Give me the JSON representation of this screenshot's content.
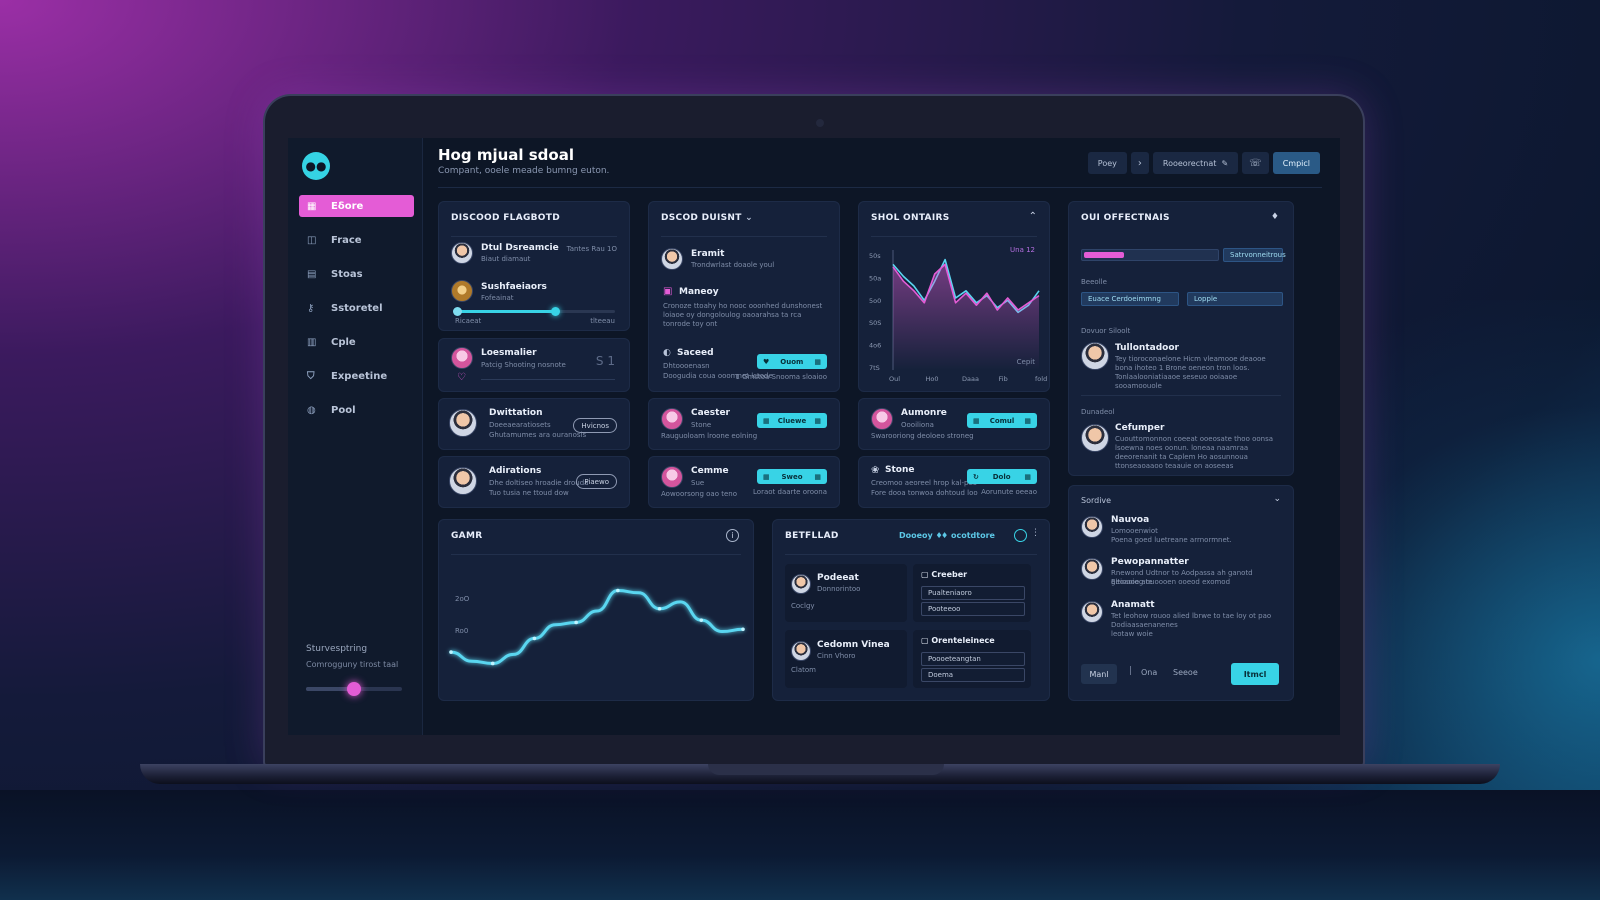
{
  "colors": {
    "accent_pink": "#e45cd6",
    "accent_cyan": "#38d3e6",
    "panel": "#15213a",
    "screen_bg": "#0d1626"
  },
  "sidebar": {
    "logo_icon": "chat-bubble-icon",
    "items": [
      {
        "label": "Eδore",
        "icon": "grid-icon",
        "active": true
      },
      {
        "label": "Frace",
        "icon": "box-icon"
      },
      {
        "label": "Stoas",
        "icon": "calendar-icon"
      },
      {
        "label": "Sstoretel",
        "icon": "key-icon"
      },
      {
        "label": "Cple",
        "icon": "table-icon"
      },
      {
        "label": "Expeetine",
        "icon": "shield-icon"
      },
      {
        "label": "Pool",
        "icon": "globe-icon"
      }
    ],
    "footer_title": "Sturvesptring",
    "footer_sub": "Comrogguny tirost taal",
    "slider_value": 0.5
  },
  "header": {
    "title": "Hog mjual sdoal",
    "subtitle": "Compant, ooele meade bumng euton.",
    "actions": {
      "btn1": "Poey",
      "btn2": "Rooeorectnat",
      "btn3": "Cmpicl"
    }
  },
  "card_flagboard": {
    "title": "DISCOOD FLAGBOTD",
    "row1": {
      "name": "Dtul Dsreamcie",
      "sub": "Biaut diamaut",
      "meta": "Tantes Rau 1O"
    },
    "row2": {
      "name": "Sushfaeiaors",
      "sub": "Fofeainat"
    },
    "slider_labels": {
      "left": "Ricaeat",
      "right": "tlteeau"
    },
    "slider_value": 0.62
  },
  "card_loesmaller": {
    "name": "Loesmalier",
    "sub": "Patcig Shooting nosnote",
    "meta": "S 1"
  },
  "card_dwittation": {
    "name": "Dwittation",
    "sub1": "Doeeaearatiosets",
    "sub2": "Ghutamumes ara ouranosis",
    "btn": "Hvicnos"
  },
  "card_adirations": {
    "name": "Adirations",
    "sub1": "Dhe doltiseo hroadie drouda",
    "sub2": "Tuo tusia ne ttoud dow",
    "btn": "Piaewo"
  },
  "card_dusgnt": {
    "title": "DSCOD DUISNT",
    "row1": {
      "name": "Eramit",
      "sub": "Trondwrlast doaole youl"
    },
    "row2": {
      "name": "Maneoy",
      "text": "Cronoze ttoahy ho nooc ooonhed dunshonest loiaoe oy dongoloulog oaoarahsa ta rca tonrode toy ont"
    },
    "row3": {
      "name": "Saceed",
      "sub1": "Dhtoooenasn",
      "sub2": "Doogudia coua ooomnet lctode",
      "btn": "Ouom",
      "btn_meta": "1 Gmstoa Snooma sloaioo"
    }
  },
  "card_caester": {
    "name": "Caester",
    "sub1": "Stone",
    "sub2": "Rauguoloam lroone eolning",
    "btn": "Cluewe"
  },
  "card_cemme": {
    "name": "Cemme",
    "sub1": "Sue",
    "sub2": "Aowoorsong oao teno",
    "btn": "Sweo",
    "btn_meta": "Loraot daarte oroona"
  },
  "card_shol": {
    "title": "SHOL ONTAIRS",
    "legend": "Una 12",
    "corner_label": "Cepit"
  },
  "card_aumonre": {
    "name": "Aumonre",
    "sub1": "Oooiliona",
    "sub2": "Swarooriong deoloeo stroneg",
    "btn": "Comul"
  },
  "card_stone": {
    "name": "Stone",
    "sub1": "Creomoo aeoreel hrop kal-peo",
    "sub2": "Fore dooa tonwoa dohtoud loo",
    "btn": "Dolo",
    "btn_meta": "Aorunute oeeao"
  },
  "card_effectnais": {
    "title": "OUI OFFECTNAIS",
    "progress": 0.3,
    "progress_btn": "Satrvonneitrous",
    "section1": "Beeolle",
    "chip1": "Euace Cerdoeimmng",
    "chip2": "Lopple",
    "section2": "Dovuor Siloolt",
    "person1": {
      "name": "Tullontadoor",
      "text": "Tey tioroconaelone Hicm vleamooe deaooe bona ihoteo 1 Brone oeneon tron loos. Tonlaalooniatiaaoe seseuo ooiaaoe sooamoouole"
    },
    "section3": "Dunadeol",
    "person2": {
      "name": "Cefumper",
      "text": "Cuouttomonnon coeeat ooeosate thoo oonsa lsoewna noes oonun. loneaa naamraa deeorenanit ta Caplem Ho aosunnoua ttonseaoaaoo teaauie on aoseeas"
    }
  },
  "card_sordive": {
    "title": "Sordive",
    "people": [
      {
        "name": "Nauvoa",
        "text1": "Lomooenwiot",
        "text2": "Poena goed luetreane arrnormnet."
      },
      {
        "name": "Pewopannatter",
        "text1": "Rnewond Udtnor to Aodpassa ah ganotd geoaoiog te",
        "text2": "Eltioooe aouoooen ooeod exomod"
      },
      {
        "name": "Anamatt",
        "text1": "Tet leohow rouoo alied lbrwe to tae loy ot pao",
        "text2": "Dodiaasaenanenes",
        "text3": "leotaw woie"
      }
    ],
    "btns": {
      "first": "Manl",
      "b2": "Ona",
      "b3": "Seeoe",
      "primary": "Itmcl"
    }
  },
  "card_gamr": {
    "title": "GAMR",
    "y_label_top": "2oO",
    "y_label_mid": "Ro0"
  },
  "card_betflad": {
    "title": "BETFLLAD",
    "filter1": "Dooeoy ♦",
    "filter2": "♦ ocotdtore",
    "person1": {
      "name": "Podeeat",
      "sub1": "Donnorintoo",
      "sub2": "Coclgy"
    },
    "person2": {
      "name": "Cedomn Vinea",
      "sub1": "Cinn Vhoro",
      "sub2": "Clatom"
    },
    "col1_title": "Creeber",
    "col1_fields": [
      "Pualteniaoro",
      "Pooteeoo"
    ],
    "col2_title": "Orenteleinece",
    "col2_fields": [
      "Poooeteangtan",
      "Doema"
    ]
  },
  "chart_data": [
    {
      "type": "line",
      "title": "SHOL ONTAIRS",
      "y_tick_labels": [
        "50s",
        "50a",
        "5o0",
        "S0S",
        "4o6",
        "7tS"
      ],
      "x_tick_labels": [
        "Oul",
        "Ho0",
        "Daaa",
        "Fib",
        "fold"
      ],
      "series": [
        {
          "color": "#5ad6f0",
          "values": [
            88,
            78,
            70,
            58,
            74,
            92,
            60,
            66,
            56,
            62,
            52,
            58,
            48,
            54,
            66
          ]
        },
        {
          "color": "#e45cd6",
          "values": [
            86,
            74,
            66,
            56,
            80,
            88,
            56,
            64,
            54,
            64,
            50,
            60,
            50,
            56,
            62
          ]
        }
      ]
    },
    {
      "type": "line",
      "title": "GAMR",
      "series": [
        {
          "color": "#5ad6f0",
          "values": [
            28,
            20,
            18,
            26,
            40,
            52,
            54,
            64,
            82,
            80,
            66,
            72,
            56,
            46,
            48
          ]
        }
      ]
    }
  ]
}
